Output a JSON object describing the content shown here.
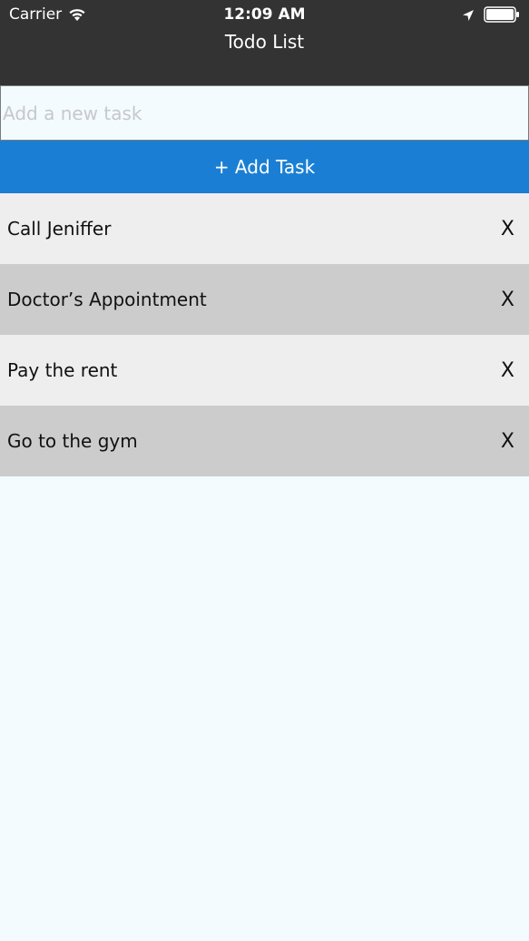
{
  "status_bar": {
    "carrier": "Carrier",
    "time": "12:09 AM",
    "icons": [
      "wifi-icon",
      "location-icon",
      "battery-icon"
    ]
  },
  "header": {
    "title": "Todo List"
  },
  "input": {
    "placeholder": "Add a new task",
    "value": ""
  },
  "add_button": {
    "label": "+ Add Task"
  },
  "tasks": [
    {
      "text": "Call Jeniffer",
      "delete_label": "X"
    },
    {
      "text": "Doctor’s Appointment",
      "delete_label": "X"
    },
    {
      "text": "Pay the rent",
      "delete_label": "X"
    },
    {
      "text": "Go to the gym",
      "delete_label": "X"
    }
  ],
  "colors": {
    "header_bg": "#333333",
    "accent": "#1a7fd4",
    "row_light": "#eeeeee",
    "row_dark": "#cccccc",
    "page_bg": "#f3fbff"
  }
}
